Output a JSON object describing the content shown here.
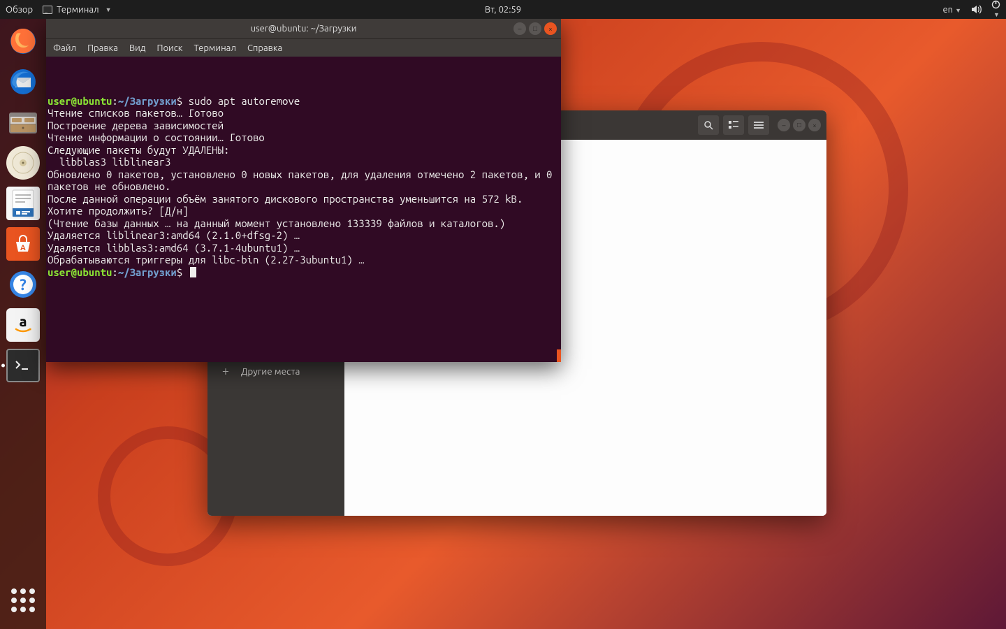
{
  "topbar": {
    "activities": "Обзор",
    "app_name": "Терминал",
    "clock": "Вт, 02:59",
    "lang": "en"
  },
  "dock": {
    "items": [
      {
        "name": "firefox",
        "color": "#ff7139"
      },
      {
        "name": "thunderbird",
        "color": "#2f6fd0"
      },
      {
        "name": "files",
        "color": "#d79a5b"
      },
      {
        "name": "rhythmbox",
        "color": "#f4e7b4"
      },
      {
        "name": "libreoffice-writer",
        "color": "#2d71b8"
      },
      {
        "name": "ubuntu-software",
        "color": "#e95420"
      },
      {
        "name": "help",
        "color": "#3584e4"
      },
      {
        "name": "amazon",
        "color": "#f4f4f4"
      },
      {
        "name": "terminal",
        "color": "#2c2c2c"
      }
    ]
  },
  "files_window": {
    "sidebar_item": "Другие места"
  },
  "terminal": {
    "title": "user@ubuntu: ~/Загрузки",
    "menu": [
      "Файл",
      "Правка",
      "Вид",
      "Поиск",
      "Терминал",
      "Справка"
    ],
    "prompt": {
      "user": "user@ubuntu",
      "sep1": ":",
      "path": "~/Загрузки",
      "sigil": "$"
    },
    "command": "sudo apt autoremove",
    "output": [
      "Чтение списков пакетов… Готово",
      "Построение дерева зависимостей",
      "Чтение информации о состоянии… Готово",
      "Следующие пакеты будут УДАЛЕНЫ:",
      "  libblas3 liblinear3",
      "Обновлено 0 пакетов, установлено 0 новых пакетов, для удаления отмечено 2 пакетов, и 0 пакетов не обновлено.",
      "После данной операции объём занятого дискового пространства уменьшится на 572 kB.",
      "Хотите продолжить? [Д/н]",
      "(Чтение базы данных … на данный момент установлено 133339 файлов и каталогов.)",
      "Удаляется liblinear3:amd64 (2.1.0+dfsg-2) …",
      "Удаляется libblas3:amd64 (3.7.1-4ubuntu1) …",
      "Обрабатываются триггеры для libc-bin (2.27-3ubuntu1) …"
    ]
  }
}
